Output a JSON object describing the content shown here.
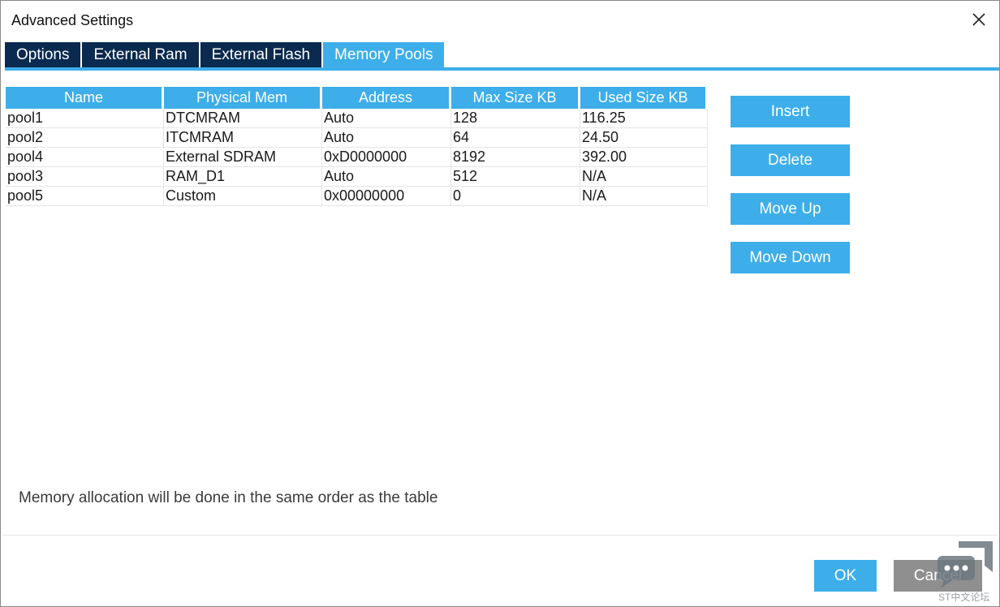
{
  "window": {
    "title": "Advanced Settings"
  },
  "icons": {
    "close": "close-icon",
    "watermark": "chat-bubble-icon"
  },
  "tabs": [
    {
      "label": "Options",
      "active": false
    },
    {
      "label": "External Ram",
      "active": false
    },
    {
      "label": "External Flash",
      "active": false
    },
    {
      "label": "Memory Pools",
      "active": true
    }
  ],
  "table": {
    "columns": [
      "Name",
      "Physical Mem",
      "Address",
      "Max Size KB",
      "Used Size KB"
    ],
    "rows": [
      [
        "pool1",
        "DTCMRAM",
        "Auto",
        "128",
        "116.25"
      ],
      [
        "pool2",
        "ITCMRAM",
        "Auto",
        "64",
        "24.50"
      ],
      [
        "pool4",
        "External SDRAM",
        "0xD0000000",
        "8192",
        "392.00"
      ],
      [
        "pool3",
        "RAM_D1",
        "Auto",
        "512",
        "N/A"
      ],
      [
        "pool5",
        "Custom",
        "0x00000000",
        "0",
        "N/A"
      ]
    ]
  },
  "actions": {
    "insert": "Insert",
    "delete": "Delete",
    "move_up": "Move Up",
    "move_down": "Move Down"
  },
  "info": "Memory allocation will be done in the same order as the table",
  "footer": {
    "ok": "OK",
    "cancel": "Cancel"
  },
  "watermark": {
    "text": "ST中文论坛"
  },
  "colors": {
    "accent": "#3daee9",
    "tab_dark": "#0a2a4f",
    "cancel": "#8f8f8f"
  }
}
